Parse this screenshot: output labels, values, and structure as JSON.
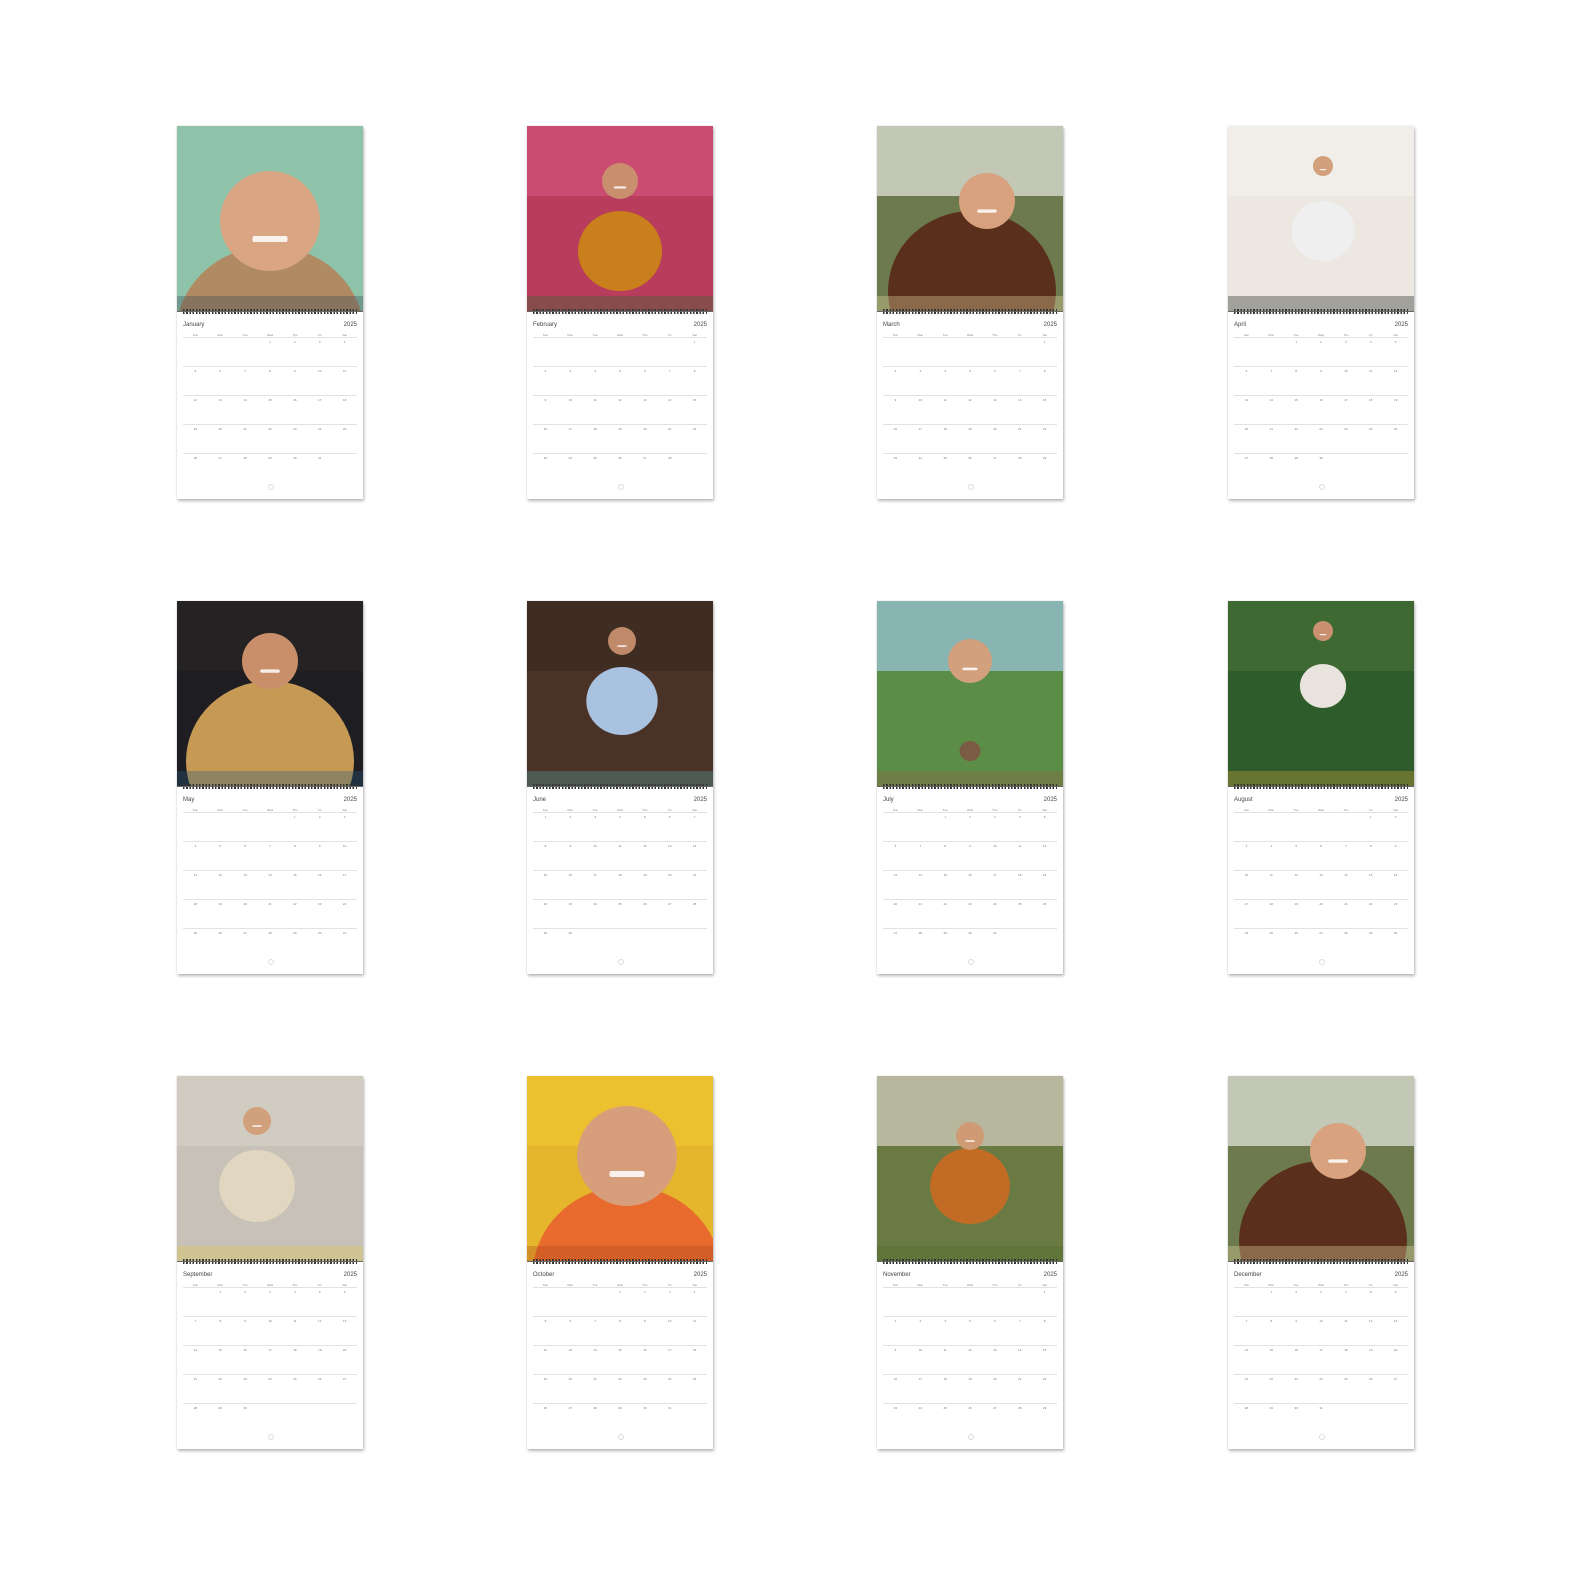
{
  "year": "2025",
  "weekdays": [
    "Sun",
    "Mon",
    "Tue",
    "Wed",
    "Thu",
    "Fri",
    "Sat"
  ],
  "months": [
    {
      "name": "January",
      "photo": "man-with-cigar"
    },
    {
      "name": "February",
      "photo": "man-with-flowers"
    },
    {
      "name": "March",
      "photo": "man-eating-noodles"
    },
    {
      "name": "April",
      "photo": "man-on-balcony"
    },
    {
      "name": "May",
      "photo": "man-in-cowboy-hat"
    },
    {
      "name": "June",
      "photo": "man-by-pool"
    },
    {
      "name": "July",
      "photo": "man-behind-fence"
    },
    {
      "name": "August",
      "photo": "man-with-dogs"
    },
    {
      "name": "September",
      "photo": "man-in-doorway"
    },
    {
      "name": "October",
      "photo": "man-yellow-background"
    },
    {
      "name": "November",
      "photo": "man-in-garden"
    },
    {
      "name": "December",
      "photo": "man-eating-noodles"
    }
  ]
}
